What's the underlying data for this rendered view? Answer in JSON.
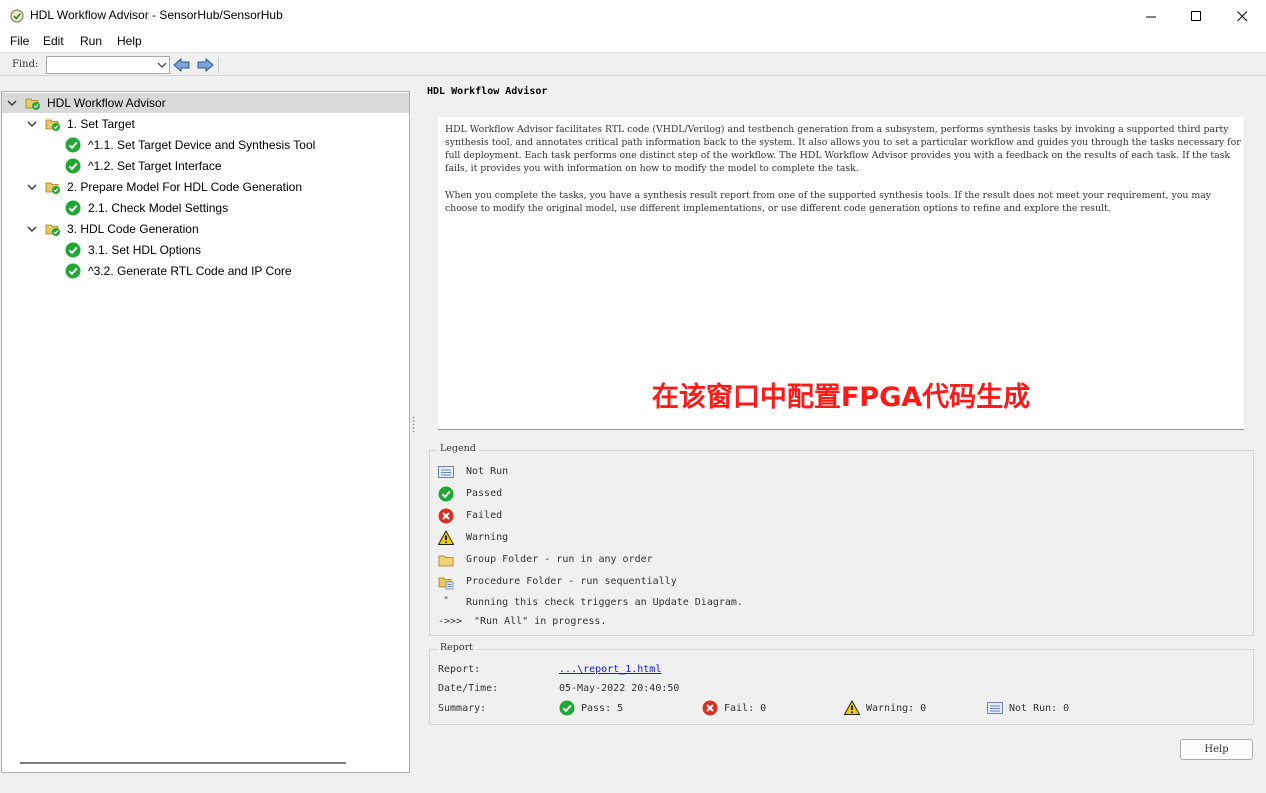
{
  "window": {
    "title": "HDL Workflow Advisor - SensorHub/SensorHub",
    "icon": "green-check-icon"
  },
  "menu": [
    "File",
    "Edit",
    "Run",
    "Help"
  ],
  "toolbar": {
    "find_label": "Find:",
    "find_value": ""
  },
  "tree": {
    "root": "HDL Workflow Advisor",
    "items": [
      {
        "label": "1. Set Target",
        "level": 1,
        "type": "procedure-folder"
      },
      {
        "label": "^1.1. Set Target Device and Synthesis Tool",
        "level": 2,
        "status": "passed"
      },
      {
        "label": "^1.2. Set Target Interface",
        "level": 2,
        "status": "passed"
      },
      {
        "label": "2. Prepare Model For HDL Code Generation",
        "level": 1,
        "type": "procedure-folder"
      },
      {
        "label": "2.1. Check Model Settings",
        "level": 2,
        "status": "passed"
      },
      {
        "label": "3. HDL Code Generation",
        "level": 1,
        "type": "procedure-folder"
      },
      {
        "label": "3.1. Set HDL Options",
        "level": 2,
        "status": "passed"
      },
      {
        "label": "^3.2. Generate RTL Code and IP Core",
        "level": 2,
        "status": "passed"
      }
    ]
  },
  "main": {
    "title": "HDL Workflow Advisor",
    "description_p1": "HDL Workflow Advisor facilitates RTL code (VHDL/Verilog) and testbench generation from a subsystem, performs synthesis tasks by invoking a supported third party synthesis tool, and annotates critical path information back to the system. It also allows you to set a particular workflow and guides you through the tasks necessary for full deployment. Each task performs one distinct step of the workflow. The HDL Workflow Advisor provides you with a feedback on the results of each task. If the task fails, it provides you with information on how to modify the model to complete the task.",
    "description_p2": "When you complete the tasks, you have a synthesis result report from one of the supported synthesis tools. If the result does not meet your requirement, you may choose to modify the original model, use different implementations, or use different code generation options to refine and explore the result.",
    "annotation": "在该窗口中配置FPGA代码生成",
    "annotation_color": "#ff1a1a"
  },
  "legend": {
    "title": "Legend",
    "items": [
      {
        "icon": "not-run-icon",
        "label": "Not Run"
      },
      {
        "icon": "passed-icon",
        "label": "Passed"
      },
      {
        "icon": "failed-icon",
        "label": "Failed"
      },
      {
        "icon": "warning-icon",
        "label": "Warning"
      },
      {
        "icon": "group-folder-icon",
        "label": "Group Folder - run in any order"
      },
      {
        "icon": "procedure-folder-icon",
        "label": "Procedure Folder - run sequentially"
      },
      {
        "icon": "update-diagram-icon",
        "label": "Running this check triggers an Update Diagram."
      },
      {
        "icon": "run-all-arrow",
        "label": "\"Run All\" in progress.",
        "prefix": "->>>"
      }
    ]
  },
  "report": {
    "title": "Report",
    "report_label": "Report:",
    "report_link": "...\\report_1.html",
    "datetime_label": "Date/Time:",
    "datetime_value": "05-May-2022 20:40:50",
    "summary_label": "Summary:",
    "pass": "Pass: 5",
    "fail": "Fail: 0",
    "warning": "Warning: 0",
    "notrun": "Not Run: 0"
  },
  "help_button": "Help",
  "colors": {
    "pass_green": "#1fa833",
    "fail_red": "#d9301f",
    "warning_yellow": "#f5d000",
    "selection": "#d9d9d9"
  }
}
